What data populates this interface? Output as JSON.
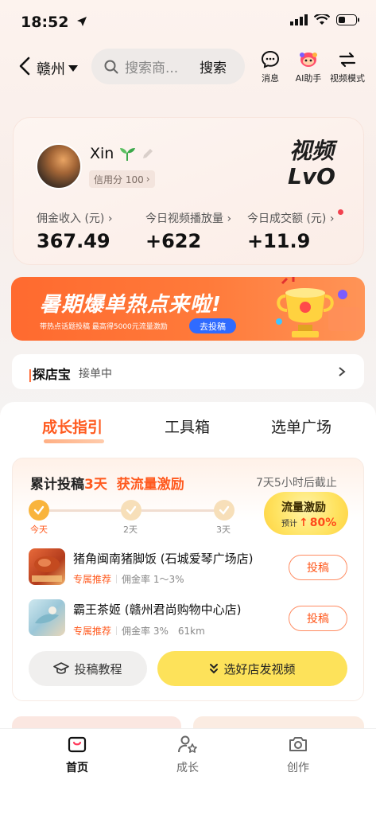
{
  "status_bar": {
    "time": "18:52"
  },
  "nav": {
    "city": "赣州",
    "search_placeholder": "搜索商...",
    "search_button": "搜索",
    "tools": [
      {
        "label": "消息",
        "icon": "message-icon"
      },
      {
        "label": "AI助手",
        "icon": "ai-assistant-icon"
      },
      {
        "label": "视频模式",
        "icon": "switch-icon"
      }
    ]
  },
  "profile": {
    "name": "Xin",
    "credit": "信用分 100",
    "level_line1": "视频",
    "level_line2": "LvO",
    "stats": [
      {
        "label": "佣金收入 (元)",
        "value": "367.49"
      },
      {
        "label": "今日视频播放量",
        "value": "+622"
      },
      {
        "label": "今日成交额 (元)",
        "value": "+11.9"
      }
    ]
  },
  "banner": {
    "title": "暑期爆单热点来啦!",
    "subtitle": "带热点话题投稿 最高得5000元流量激励",
    "button": "去投稿"
  },
  "shop": {
    "title": "探店宝",
    "status": "接单中"
  },
  "tabs": [
    {
      "label": "成长指引",
      "active": true
    },
    {
      "label": "工具箱",
      "active": false
    },
    {
      "label": "选单广场",
      "active": false
    }
  ],
  "growth": {
    "title_prefix": "累计投稿",
    "title_days": "3天",
    "title_reward": "获流量激励",
    "deadline": "7天5小时后截止",
    "steps": [
      "今天",
      "2天",
      "3天"
    ],
    "reward_title": "流量激励",
    "reward_prefix": "预计",
    "reward_pct": "80%",
    "stores": [
      {
        "name": "猪角闽南猪脚饭 (石城爱琴广场店)",
        "tag": "专属推荐",
        "commission": "佣金率 1～3%",
        "distance": "",
        "button": "投稿"
      },
      {
        "name": "霸王茶姬 (赣州君尚购物中心店)",
        "tag": "专属推荐",
        "commission": "佣金率 3%",
        "distance": "61km",
        "button": "投稿"
      }
    ],
    "tutorial_button": "投稿教程",
    "select_button": "选好店发视频"
  },
  "bottom_nav": [
    {
      "label": "首页",
      "icon": "home-icon",
      "active": true
    },
    {
      "label": "成长",
      "icon": "growth-icon",
      "active": false
    },
    {
      "label": "创作",
      "icon": "camera-icon",
      "active": false
    }
  ],
  "colors": {
    "accent": "#ff5a1f",
    "yellow": "#fde25a",
    "blue": "#2f6bff"
  }
}
